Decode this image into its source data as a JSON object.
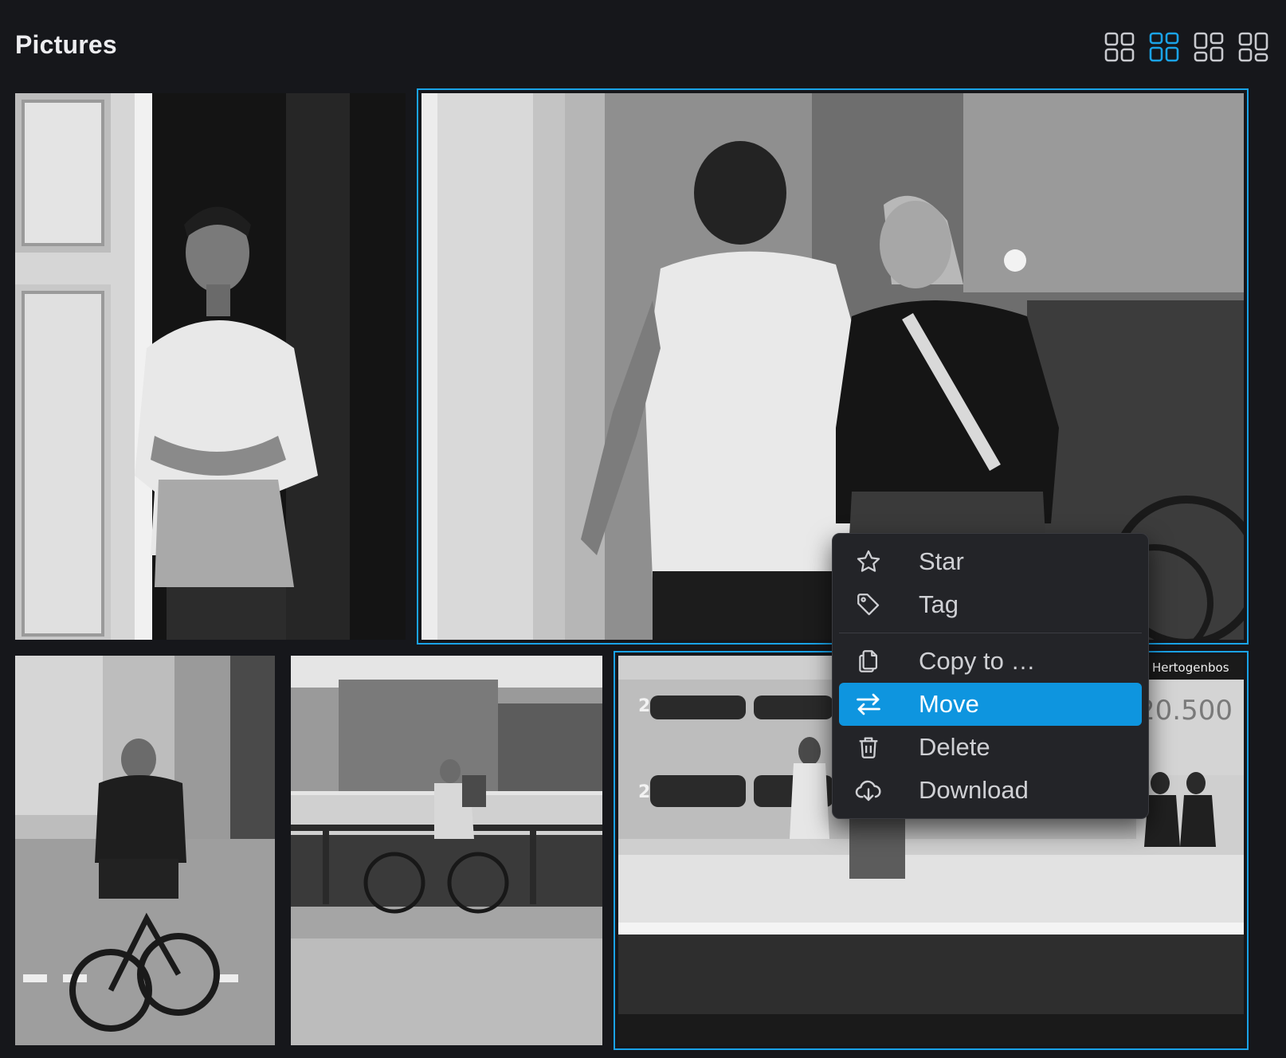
{
  "header": {
    "title": "Pictures"
  },
  "view_switcher": {
    "options": [
      {
        "icon": "grid-small-icon",
        "active": false
      },
      {
        "icon": "grid-medium-icon",
        "active": true
      },
      {
        "icon": "grid-large-icon",
        "active": false
      },
      {
        "icon": "grid-xlarge-icon",
        "active": false
      }
    ],
    "accent_color": "#1aa3e8",
    "inactive_color": "#c9cacf"
  },
  "gallery": {
    "photos": [
      {
        "subject": "man-in-doorway",
        "selected": false
      },
      {
        "subject": "couple-walking",
        "selected": true
      },
      {
        "subject": "cyclist-on-phone",
        "selected": false
      },
      {
        "subject": "cyclist-by-water",
        "selected": false
      },
      {
        "subject": "train-platform",
        "selected": true,
        "sign_text": "Hertogenbos",
        "platform_numbers": [
          "2",
          "2"
        ],
        "poster_text": "20.500"
      }
    ]
  },
  "context_menu": {
    "items": [
      {
        "label": "Star",
        "icon": "star-icon",
        "active": false
      },
      {
        "label": "Tag",
        "icon": "tag-icon",
        "active": false
      },
      {
        "label": "Copy to …",
        "icon": "copy-icon",
        "active": false
      },
      {
        "label": "Move",
        "icon": "move-arrows-icon",
        "active": true
      },
      {
        "label": "Delete",
        "icon": "trash-icon",
        "active": false
      },
      {
        "label": "Download",
        "icon": "cloud-download-icon",
        "active": false
      }
    ],
    "active_color": "#0e95df"
  }
}
